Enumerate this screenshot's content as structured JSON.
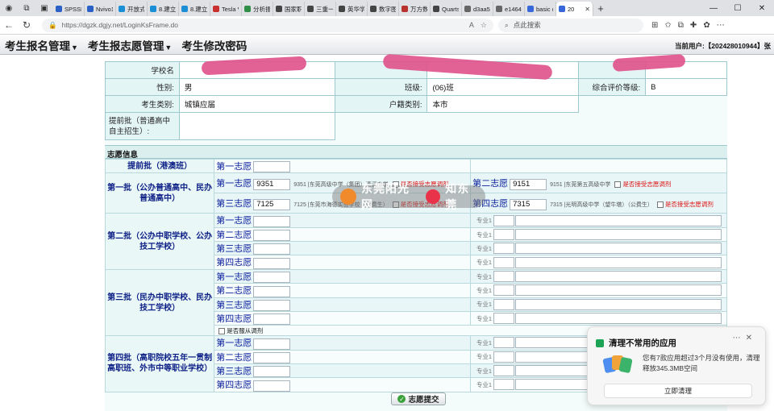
{
  "browser": {
    "tabs": [
      {
        "label": "SPSSPF",
        "color": "#2b61c7"
      },
      {
        "label": "Nvivo1",
        "color": "#2b61c7"
      },
      {
        "label": "开放式",
        "color": "#1a8fd6"
      },
      {
        "label": "8.建立",
        "color": "#1a8fd6"
      },
      {
        "label": "8.建立",
        "color": "#1a8fd6"
      },
      {
        "label": "Tesla V",
        "color": "#c8312f"
      },
      {
        "label": "分析振",
        "color": "#2f8f46"
      },
      {
        "label": "国家职",
        "color": "#444"
      },
      {
        "label": "三重一",
        "color": "#444"
      },
      {
        "label": "英华学",
        "color": "#444"
      },
      {
        "label": "数字图",
        "color": "#444"
      },
      {
        "label": "万方数",
        "color": "#b8332b"
      },
      {
        "label": "Quarts",
        "color": "#444"
      },
      {
        "label": "d3aa5",
        "color": "#666"
      },
      {
        "label": "e1464",
        "color": "#666"
      },
      {
        "label": "basic c",
        "color": "#3767d8"
      },
      {
        "label": "20",
        "color": "#3767d8"
      }
    ],
    "url": "https://dgzk.dgjy.net/LoginKsFrame.do",
    "search_placeholder": "点此搜索"
  },
  "menu": {
    "items": [
      "考生报名管理",
      "考生报志愿管理",
      "考生修改密码"
    ],
    "current_user": "当前用户:【202428010944】张"
  },
  "student": {
    "school_label": "学校名",
    "gender_label": "性别:",
    "gender": "男",
    "class_label": "班级:",
    "class": "(06)班",
    "eval_label": "综合评价等级:",
    "eval": "B",
    "category_label": "考生类别:",
    "category": "城镇应届",
    "hukou_label": "户籍类别:",
    "hukou": "本市",
    "early_label": "提前批（普通高中自主招生）:"
  },
  "volunteer": {
    "section_title": "志愿信息",
    "early_batch": {
      "name": "提前批（港澳班）",
      "pref": "第一志愿"
    },
    "batch1": {
      "name": "第一批（公办普通高中、民办普通高中）",
      "choices": [
        {
          "pref": "第一志愿",
          "code": "9351",
          "school": "9351 |东莞高级中学（集团）清溪中学",
          "check": "是否接受志愿调剂"
        },
        {
          "pref": "第二志愿",
          "code": "9151",
          "school": "9151 |东莞第五高级中学",
          "check": "是否接受志愿调剂"
        },
        {
          "pref": "第三志愿",
          "code": "7125",
          "school": "7125 |东莞市海德实验学校（公费生）",
          "check": "是否接受志愿调剂"
        },
        {
          "pref": "第四志愿",
          "code": "7315",
          "school": "7315 |光明高级中学（望牛墩）（公费生）",
          "check": "是否接受志愿调剂"
        }
      ]
    },
    "batch2": {
      "name": "第二批（公办中职学校、公办技工学校）",
      "prefs": [
        "第一志愿",
        "第二志愿",
        "第三志愿",
        "第四志愿"
      ],
      "major": "专业1"
    },
    "batch3": {
      "name": "第三批（民办中职学校、民办技工学校）",
      "prefs": [
        "第一志愿",
        "第二志愿",
        "第三志愿",
        "第四志愿"
      ],
      "major": "专业1",
      "obey": "是否服从调剂"
    },
    "batch4": {
      "name": "第四批（高职院校五年一贯制高职班、外市中等职业学校）",
      "prefs": [
        "第一志愿",
        "第二志愿",
        "第三志愿",
        "第四志愿"
      ],
      "major": "专业1"
    },
    "submit_label": "志愿提交"
  },
  "watermark": {
    "text1": "东莞阳光网",
    "text2": "知东莞"
  },
  "toast": {
    "title": "清理不常用的应用",
    "message": "您有7款应用超过3个月没有使用，清理释放345.3MB空间",
    "button": "立即清理"
  }
}
